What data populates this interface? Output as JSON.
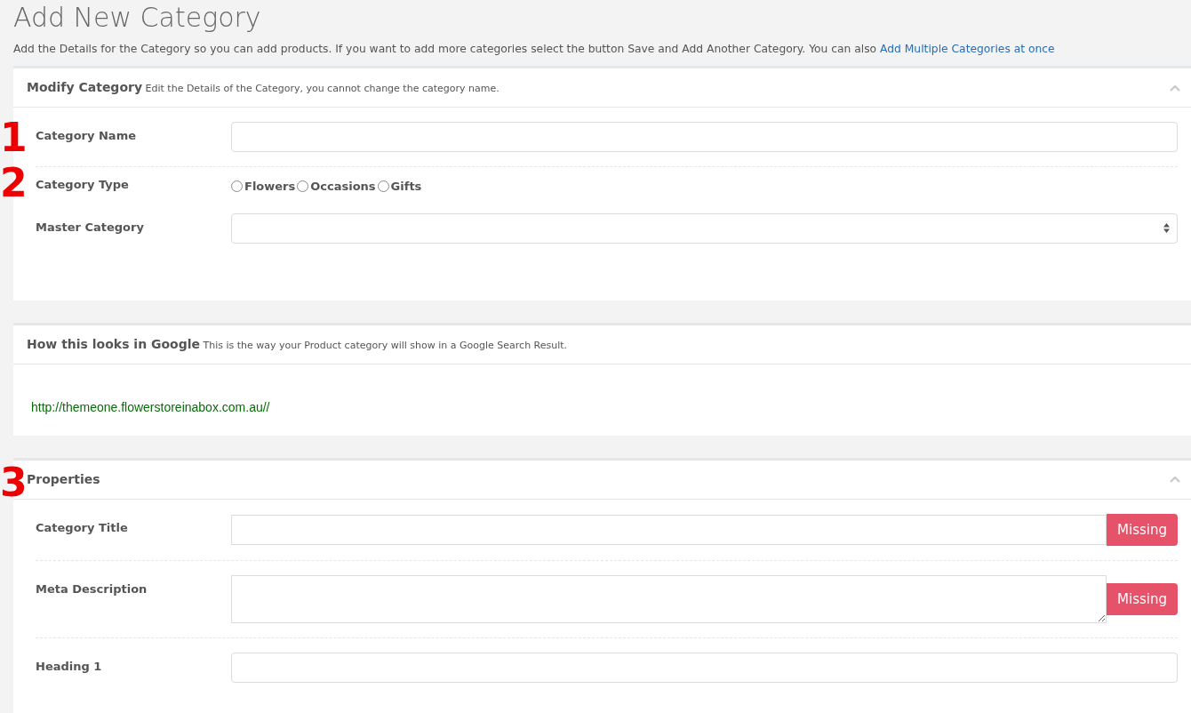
{
  "page": {
    "title": "Add New Category",
    "description": "Add the Details for the Category so you can add products. If you want to add more categories select the button Save and Add Another Category. You can also",
    "description_link": "Add Multiple Categories at once"
  },
  "sections": [
    {
      "kind": "form",
      "title": "Modify Category",
      "subtitle": "Edit the Details of the Category, you cannot change the category name.",
      "collapsible": true,
      "fields": [
        {
          "kind": "text",
          "label": "Category Name",
          "annotation": "1"
        },
        {
          "kind": "radio",
          "label": "Category Type",
          "annotation": "2",
          "options": [
            {
              "label": "Flowers",
              "selected": false
            },
            {
              "label": "Occasions",
              "selected": false
            },
            {
              "label": "Gifts",
              "selected": false
            }
          ]
        },
        {
          "kind": "select",
          "label": "Master Category"
        }
      ]
    },
    {
      "kind": "preview",
      "title": "How this looks in Google",
      "subtitle": "This is the way your Product category will show in a Google Search Result.",
      "collapsible": false,
      "url": "http://themeone.flowerstoreinabox.com.au//"
    },
    {
      "kind": "form",
      "title": "Properties",
      "annotation": "3",
      "collapsible": true,
      "fields": [
        {
          "kind": "text",
          "label": "Category Title",
          "status": "Missing"
        },
        {
          "kind": "textarea",
          "label": "Meta Description",
          "status": "Missing"
        },
        {
          "kind": "text",
          "label": "Heading 1"
        }
      ]
    }
  ]
}
